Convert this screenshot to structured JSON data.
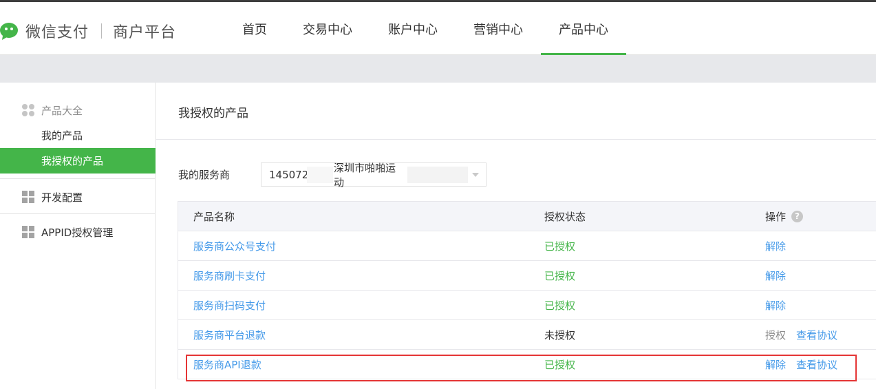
{
  "header": {
    "brand": "微信支付",
    "platform": "商户平台",
    "nav": [
      {
        "label": "首页",
        "active": false
      },
      {
        "label": "交易中心",
        "active": false
      },
      {
        "label": "账户中心",
        "active": false
      },
      {
        "label": "营销中心",
        "active": false
      },
      {
        "label": "产品中心",
        "active": true
      }
    ]
  },
  "sidebar": {
    "group1": {
      "title": "产品大全",
      "icon": "apps-circles-icon"
    },
    "items": [
      {
        "label": "我的产品",
        "active": false
      },
      {
        "label": "我授权的产品",
        "active": true
      }
    ],
    "dev_config": {
      "label": "开发配置",
      "icon": "grid-icon"
    },
    "appid": {
      "label": "APPID授权管理",
      "icon": "grid-icon"
    }
  },
  "main": {
    "title": "我授权的产品",
    "provider_label": "我的服务商",
    "provider_id": "145072",
    "provider_name": "深圳市啪啪运动",
    "table": {
      "headers": [
        "产品名称",
        "授权状态",
        "操作"
      ],
      "rows": [
        {
          "name": "服务商公众号支付",
          "status": "已授权",
          "actions": [
            "解除"
          ]
        },
        {
          "name": "服务商刷卡支付",
          "status": "已授权",
          "actions": [
            "解除"
          ]
        },
        {
          "name": "服务商扫码支付",
          "status": "已授权",
          "actions": [
            "解除"
          ]
        },
        {
          "name": "服务商平台退款",
          "status": "未授权",
          "actions": [
            "授权",
            "查看协议"
          ]
        },
        {
          "name": "服务商API退款",
          "status": "已授权",
          "actions": [
            "解除",
            "查看协议"
          ]
        }
      ]
    }
  },
  "colors": {
    "accent_green": "#44b549",
    "link_blue": "#459ae9",
    "highlight_red": "#e53535"
  }
}
